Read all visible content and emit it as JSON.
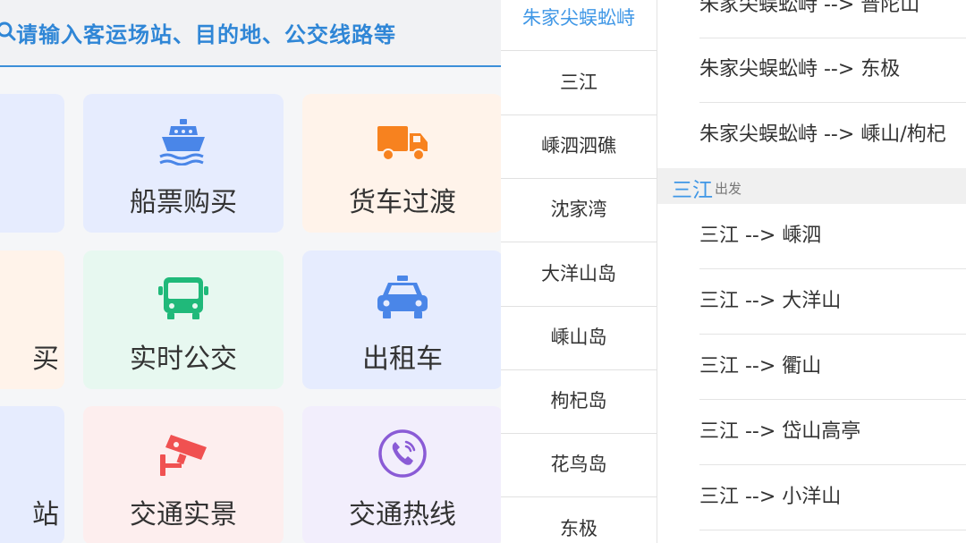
{
  "search": {
    "placeholder": "请输入客运场站、目的地、公交线路等"
  },
  "tiles": {
    "ferry_tickets": {
      "label": "船票购买",
      "icon": "ship-icon",
      "bg": "#e6ecfe",
      "icon_color": "#4a86e8"
    },
    "truck_ferry": {
      "label": "货车过渡",
      "icon": "truck-icon",
      "bg": "#fff3ea",
      "icon_color": "#f7821f"
    },
    "realtime_bus": {
      "label": "实时公交",
      "icon": "bus-icon",
      "bg": "#e7f8f0",
      "icon_color": "#20b97a"
    },
    "taxi": {
      "label": "出租车",
      "icon": "taxi-icon",
      "bg": "#e6ecfe",
      "icon_color": "#4a86e8"
    },
    "traffic_live": {
      "label": "交通实景",
      "icon": "camera-icon",
      "bg": "#fdeeee",
      "icon_color": "#f05151"
    },
    "traffic_hotline": {
      "label": "交通热线",
      "icon": "phone-icon",
      "bg": "#f2eefc",
      "icon_color": "#8a5bd6"
    },
    "partial_middle": {
      "label": "买",
      "bg": "#fff3ea"
    },
    "partial_bottom": {
      "label": "站",
      "bg": "#e6ecfe"
    },
    "partial_top": {
      "bg": "#e6ecfe"
    }
  },
  "stations": [
    {
      "name": "朱家尖蜈蚣峙",
      "active": true
    },
    {
      "name": "三江"
    },
    {
      "name": "嵊泗泗礁"
    },
    {
      "name": "沈家湾"
    },
    {
      "name": "大洋山岛"
    },
    {
      "name": "嵊山岛"
    },
    {
      "name": "枸杞岛"
    },
    {
      "name": "花鸟岛"
    },
    {
      "name": "东极"
    }
  ],
  "routes_top": [
    "朱家尖蜈蚣峙 --> 普陀山",
    "朱家尖蜈蚣峙 --> 东极",
    "朱家尖蜈蚣峙 --> 嵊山/枸杞"
  ],
  "section": {
    "name": "三江",
    "sub": "出发"
  },
  "routes_section": [
    "三江 --> 嵊泗",
    "三江 --> 大洋山",
    "三江 --> 衢山",
    "三江 --> 岱山高亭",
    "三江 --> 小洋山"
  ]
}
